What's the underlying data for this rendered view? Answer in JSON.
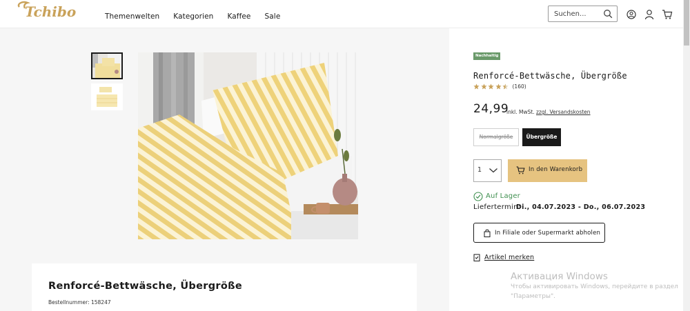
{
  "header": {
    "logo_text": "Tchibo",
    "nav": [
      "Themenwelten",
      "Kategorien",
      "Kaffee",
      "Sale"
    ],
    "search_placeholder": "Suchen...",
    "icons": [
      "search-icon",
      "locator-icon",
      "user-icon",
      "cart-icon"
    ]
  },
  "gallery": {
    "thumbnails": [
      "bedroom-photo",
      "folded-bedding-photo"
    ],
    "main_image": "yellow-striped-bedding-photo"
  },
  "info": {
    "title": "Renforcé-Bettwäsche, Übergröße",
    "sku": "Bestellnummer: 158247"
  },
  "product": {
    "badge": "Nachhaltig",
    "title": "Renforcé-Bettwäsche, Übergröße",
    "rating": 4.5,
    "rating_max": 5,
    "review_count": "(160)",
    "price": "24,99",
    "price_note": "inkl. MwSt.",
    "shipping_link": "zzgl. Versandskosten",
    "sizes": [
      {
        "label": "Normalgröße",
        "available": false
      },
      {
        "label": "Übergröße",
        "selected": true
      }
    ],
    "quantity": "1",
    "cart_label": "In den Warenkorb",
    "stock": "Auf Lager",
    "delivery_label": "Liefertermin:",
    "delivery_date": "Di., 04.07.2023 - Do., 06.07.2023",
    "pickup_label": "In Filiale oder Supermarkt abholen",
    "wishlist_label": "Artikel merken"
  },
  "watermark": {
    "title": "Активация Windows",
    "line1": "Чтобы активировать Windows, перейдите в раздел",
    "line2": "\"Параметры\"."
  },
  "colors": {
    "accent": "#e6c380",
    "stock_green": "#3f8f4f",
    "badge_green": "#6a9a6a",
    "logo_gold": "#c9a25a"
  }
}
